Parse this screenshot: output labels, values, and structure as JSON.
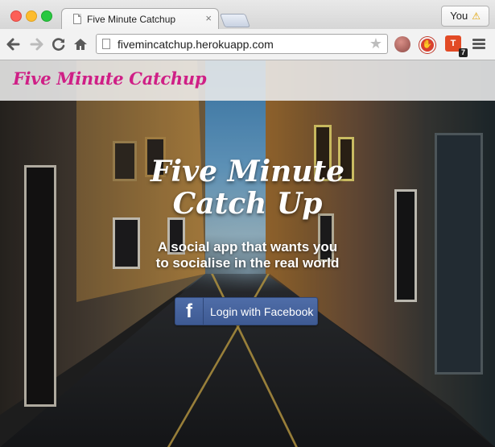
{
  "browser": {
    "tab_title": "Five Minute Catchup",
    "tab_close": "×",
    "profile_label": "You",
    "profile_warning": "⚠",
    "url": "fivemincatchup.herokuapp.com",
    "extension_badge": "7"
  },
  "site": {
    "brand": "Five Minute Catchup",
    "hero_title_line1": "Five Minute",
    "hero_title_line2": "Catch Up",
    "hero_sub_line1": "A social app that wants you",
    "hero_sub_line2": "to socialise in the real world",
    "login_button": "Login with Facebook",
    "fb_glyph": "f"
  },
  "colors": {
    "brand": "#cf1f86",
    "facebook": "#3e5a93"
  }
}
